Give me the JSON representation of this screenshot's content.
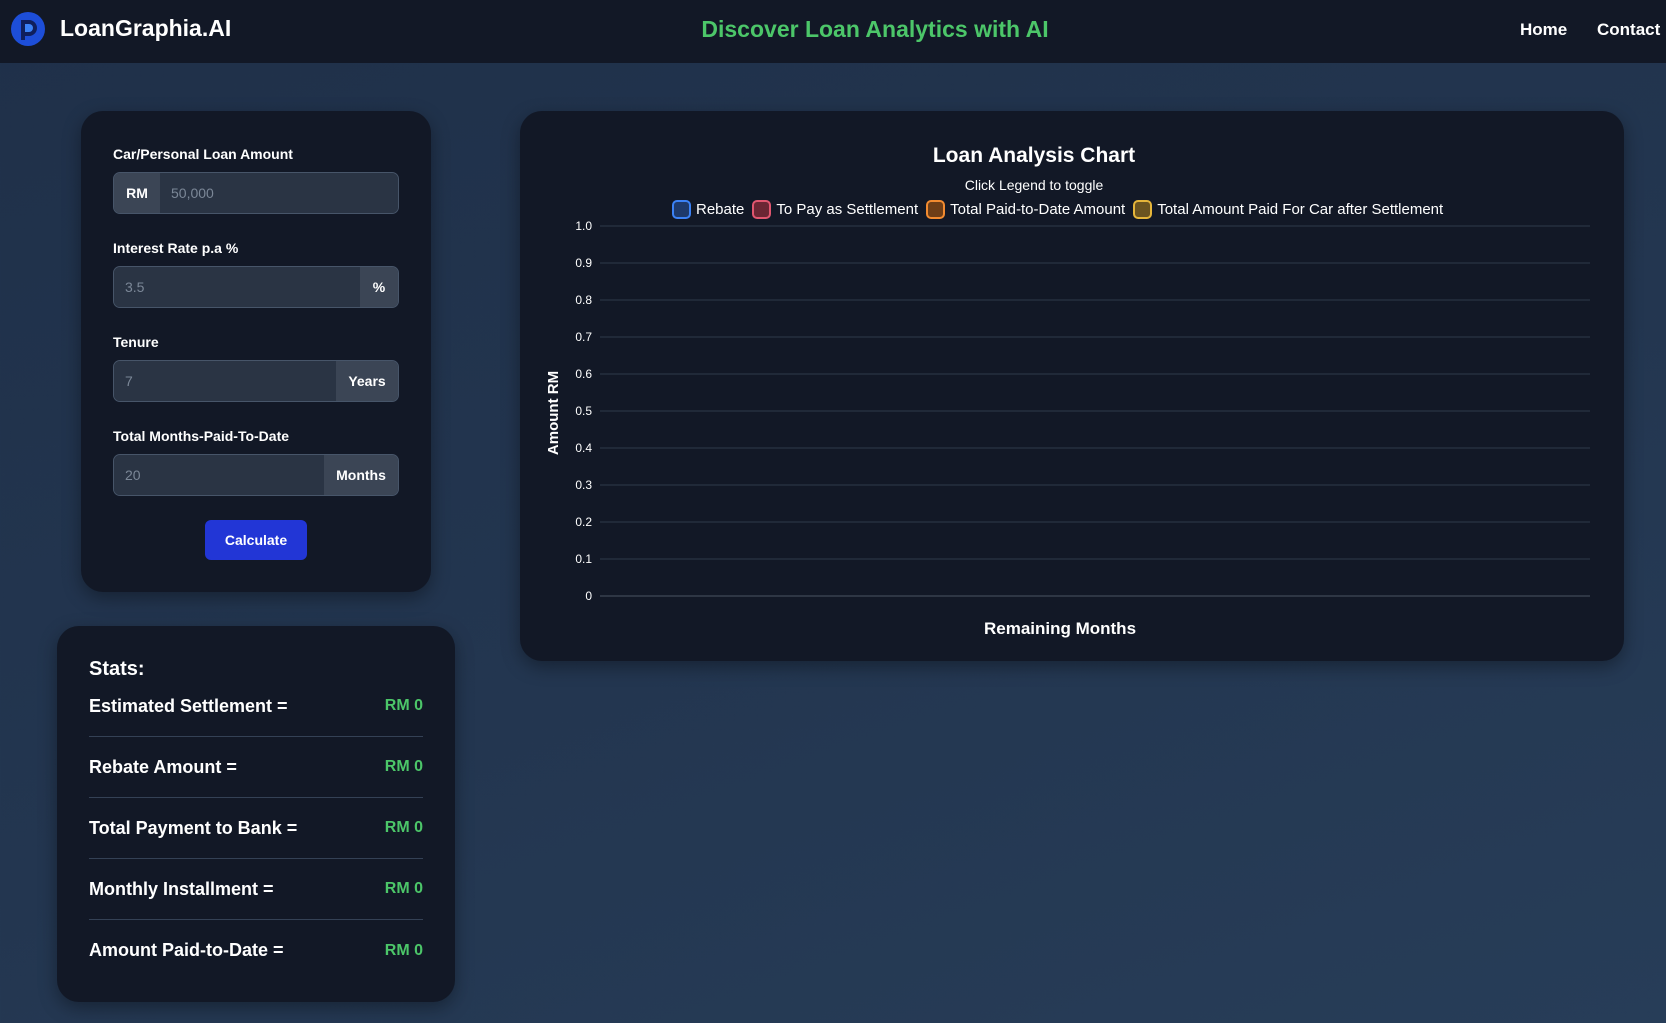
{
  "header": {
    "brand": "LoanGraphia.AI",
    "tagline": "Discover Loan Analytics with AI",
    "nav": {
      "home": "Home",
      "contact": "Contact"
    },
    "logo_icon": "loangraphia-logo-icon"
  },
  "form": {
    "loan_amount": {
      "label": "Car/Personal Loan Amount",
      "prefix": "RM",
      "placeholder": "50,000"
    },
    "interest_rate": {
      "label": "Interest Rate p.a %",
      "suffix": "%",
      "placeholder": "3.5"
    },
    "tenure": {
      "label": "Tenure",
      "suffix": "Years",
      "placeholder": "7"
    },
    "months_paid": {
      "label": "Total Months-Paid-To-Date",
      "suffix": "Months",
      "placeholder": "20"
    },
    "calculate_label": "Calculate"
  },
  "stats": {
    "title": "Stats:",
    "rows": [
      {
        "label": "Estimated Settlement =",
        "value": "RM 0"
      },
      {
        "label": "Rebate Amount =",
        "value": "RM 0"
      },
      {
        "label": "Total Payment to Bank =",
        "value": "RM 0"
      },
      {
        "label": "Monthly Installment =",
        "value": "RM 0"
      },
      {
        "label": "Amount Paid-to-Date =",
        "value": "RM 0"
      }
    ]
  },
  "chart_data": {
    "type": "line",
    "title": "Loan Analysis Chart",
    "subtitle": "Click Legend to toggle",
    "xlabel": "Remaining Months",
    "ylabel": "Amount RM",
    "ylim": [
      0,
      1.0
    ],
    "y_ticks": [
      "0",
      "0.1",
      "0.2",
      "0.3",
      "0.4",
      "0.5",
      "0.6",
      "0.7",
      "0.8",
      "0.9",
      "1.0"
    ],
    "grid": true,
    "legend_position": "top",
    "categories": [],
    "series": [
      {
        "name": "Rebate",
        "color": "#3b82f6",
        "fill": "#1e3a6b",
        "values": []
      },
      {
        "name": "To Pay as Settlement",
        "color": "#e0566f",
        "fill": "#6b2634",
        "values": []
      },
      {
        "name": "Total Paid-to-Date Amount",
        "color": "#f28b30",
        "fill": "#6e3e17",
        "values": []
      },
      {
        "name": "Total Amount Paid For Car after Settlement",
        "color": "#e5b53a",
        "fill": "#6b5420",
        "values": []
      }
    ]
  },
  "colors": {
    "background": "#233650",
    "card": "#121826",
    "accent_green": "#4cc669",
    "button_blue": "#2236d6"
  }
}
